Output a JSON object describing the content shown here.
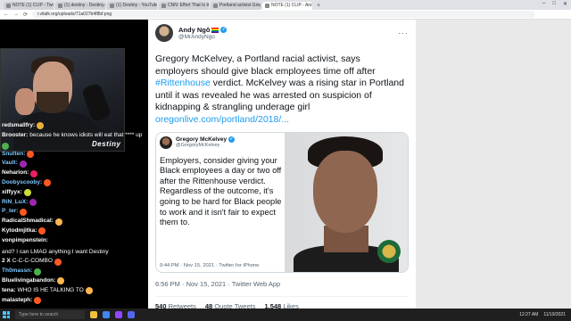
{
  "browser": {
    "tabs": [
      {
        "label": "NOTE (1) CLIP - Twitch"
      },
      {
        "label": "(1) destiny - Destiny.gg"
      },
      {
        "label": "(1) Destiny - YouTube"
      },
      {
        "label": "CNN: Effort That Is the Rhe..."
      },
      {
        "label": "Portland activist Gregory McKelvey..."
      },
      {
        "label": "NOTE (1) CLIP - Andy Ngo on Twitter"
      }
    ],
    "new_tab": "+",
    "window_controls": [
      "–",
      "□",
      "✕"
    ],
    "address": "i.vitalk.org/uploads/71a027b4f8bf.png"
  },
  "stream": {
    "logo": "Destiny",
    "chat": [
      {
        "user": "redsmallfry:",
        "msg": "",
        "color": "#ffffff",
        "emote": "#e8b03a"
      },
      {
        "user": "Brooster:",
        "msg": "because he knows idiots will eat that **** up",
        "color": "#ffffff",
        "emote": "#4caf50"
      },
      {
        "user": "Snutten:",
        "msg": "",
        "color": "#7ec8ff",
        "emote": "#ff5722"
      },
      {
        "user": "Vault:",
        "msg": "",
        "color": "#7ec8ff",
        "emote": "#9c27b0"
      },
      {
        "user": "Neharion:",
        "msg": "",
        "color": "#ffffff",
        "emote": "#e91e63"
      },
      {
        "user": "Doobyscooby:",
        "msg": "",
        "color": "#7ec8ff",
        "emote": "#ff5722"
      },
      {
        "user": "xiffyyx:",
        "msg": "",
        "color": "#ffffff",
        "emote": "#cddc39"
      },
      {
        "user": "RiN_LuX:",
        "msg": "",
        "color": "#7ec8ff",
        "emote": "#9c27b0"
      },
      {
        "user": "P_ter:",
        "msg": "",
        "color": "#7ec8ff",
        "emote": "#ff5722"
      },
      {
        "user": "RadicalShmadical:",
        "msg": "",
        "color": "#ffffff",
        "emote": "#ffb74d"
      },
      {
        "user": "Kytodmjitka:",
        "msg": "",
        "color": "#ffffff",
        "emote": "#ff5722"
      },
      {
        "user": "vonpimpenstein:",
        "msg": "and? I can LMAO anything I want Destiny",
        "color": "#ffffff",
        "emote": ""
      },
      {
        "user": "2 X",
        "msg": "C-C-C-COMBO",
        "color": "#ffffff",
        "emote": "#ff5722"
      },
      {
        "user": "Th0massn:",
        "msg": "",
        "color": "#7ec8ff",
        "emote": "#4caf50"
      },
      {
        "user": "Bluelivingabandon:",
        "msg": "",
        "color": "#ffffff",
        "emote": "#ffb74d"
      },
      {
        "user": "tena:",
        "msg": "WHO IS HE TALKING TO",
        "color": "#ffffff",
        "emote": "#ffb74d"
      },
      {
        "user": "malasteph:",
        "msg": "",
        "color": "#ffffff",
        "emote": "#ff5722"
      }
    ]
  },
  "tweet": {
    "name": "Andy Ngô",
    "handle": "@MrAndyNgo",
    "more": "···",
    "text_before": "Gregory McKelvey, a Portland racial activist, says employers should give black employees time off after ",
    "hashtag": "#Rittenhouse",
    "text_after": " verdict. McKelvey was a rising star in Portland until it was revealed he was arrested on suspicion of kidnapping & strangling underage girl ",
    "link": "oregonlive.com/portland/2018/...",
    "embed": {
      "name": "Gregory McKelvey",
      "handle": "@GregoryMcKelvey",
      "text": "Employers, consider giving your Black employees a day or two off after the Rittenhouse verdict. Regardless of the outcome, it's going to be hard for Black people to work and it isn't fair to expect them to.",
      "meta": "9:44 PM · Nov 15, 2021 · Twitter for iPhone"
    },
    "timestamp": "6:56 PM · Nov 15, 2021 · Twitter Web App",
    "retweets": "540",
    "retweets_label": "Retweets",
    "quotes": "48",
    "quotes_label": "Quote Tweets",
    "likes": "1,548",
    "likes_label": "Likes"
  },
  "taskbar": {
    "search": "Type here to search",
    "time": "12:27 AM",
    "date": "11/19/2021"
  }
}
